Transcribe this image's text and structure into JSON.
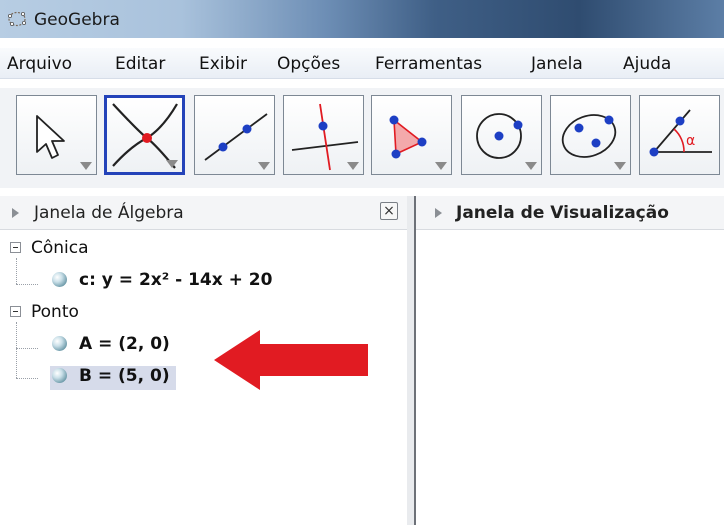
{
  "window": {
    "title": "GeoGebra",
    "icon": "geogebra-logo-icon"
  },
  "menu": [
    "Arquivo",
    "Editar",
    "Exibir",
    "Opções",
    "Ferramentas",
    "Janela",
    "Ajuda"
  ],
  "toolbar": {
    "tools": [
      {
        "name": "move-tool-icon"
      },
      {
        "name": "intersect-point-tool-icon",
        "selected": true
      },
      {
        "name": "line-tool-icon"
      },
      {
        "name": "perpendicular-line-tool-icon"
      },
      {
        "name": "polygon-tool-icon"
      },
      {
        "name": "circle-tool-icon"
      },
      {
        "name": "conic-tool-icon"
      },
      {
        "name": "angle-tool-icon"
      }
    ],
    "angle_symbol": "α"
  },
  "algebra_view": {
    "title": "Janela de Álgebra",
    "close_label": "×",
    "categories": [
      {
        "label": "Cônica",
        "items": [
          "c: y = 2x² - 14x + 20"
        ]
      },
      {
        "label": "Ponto",
        "items": [
          "A = (2, 0)",
          "B = (5, 0)"
        ]
      }
    ],
    "selected_item": "B = (5, 0)"
  },
  "graphics_view": {
    "title": "Janela de Visualização"
  },
  "annotation": {
    "type": "red-arrow",
    "points_to": "Ponto items",
    "color": "#e11b22"
  },
  "colors": {
    "selection": "#2443b9",
    "point": "#1d3fc4",
    "red": "#e11b22"
  }
}
